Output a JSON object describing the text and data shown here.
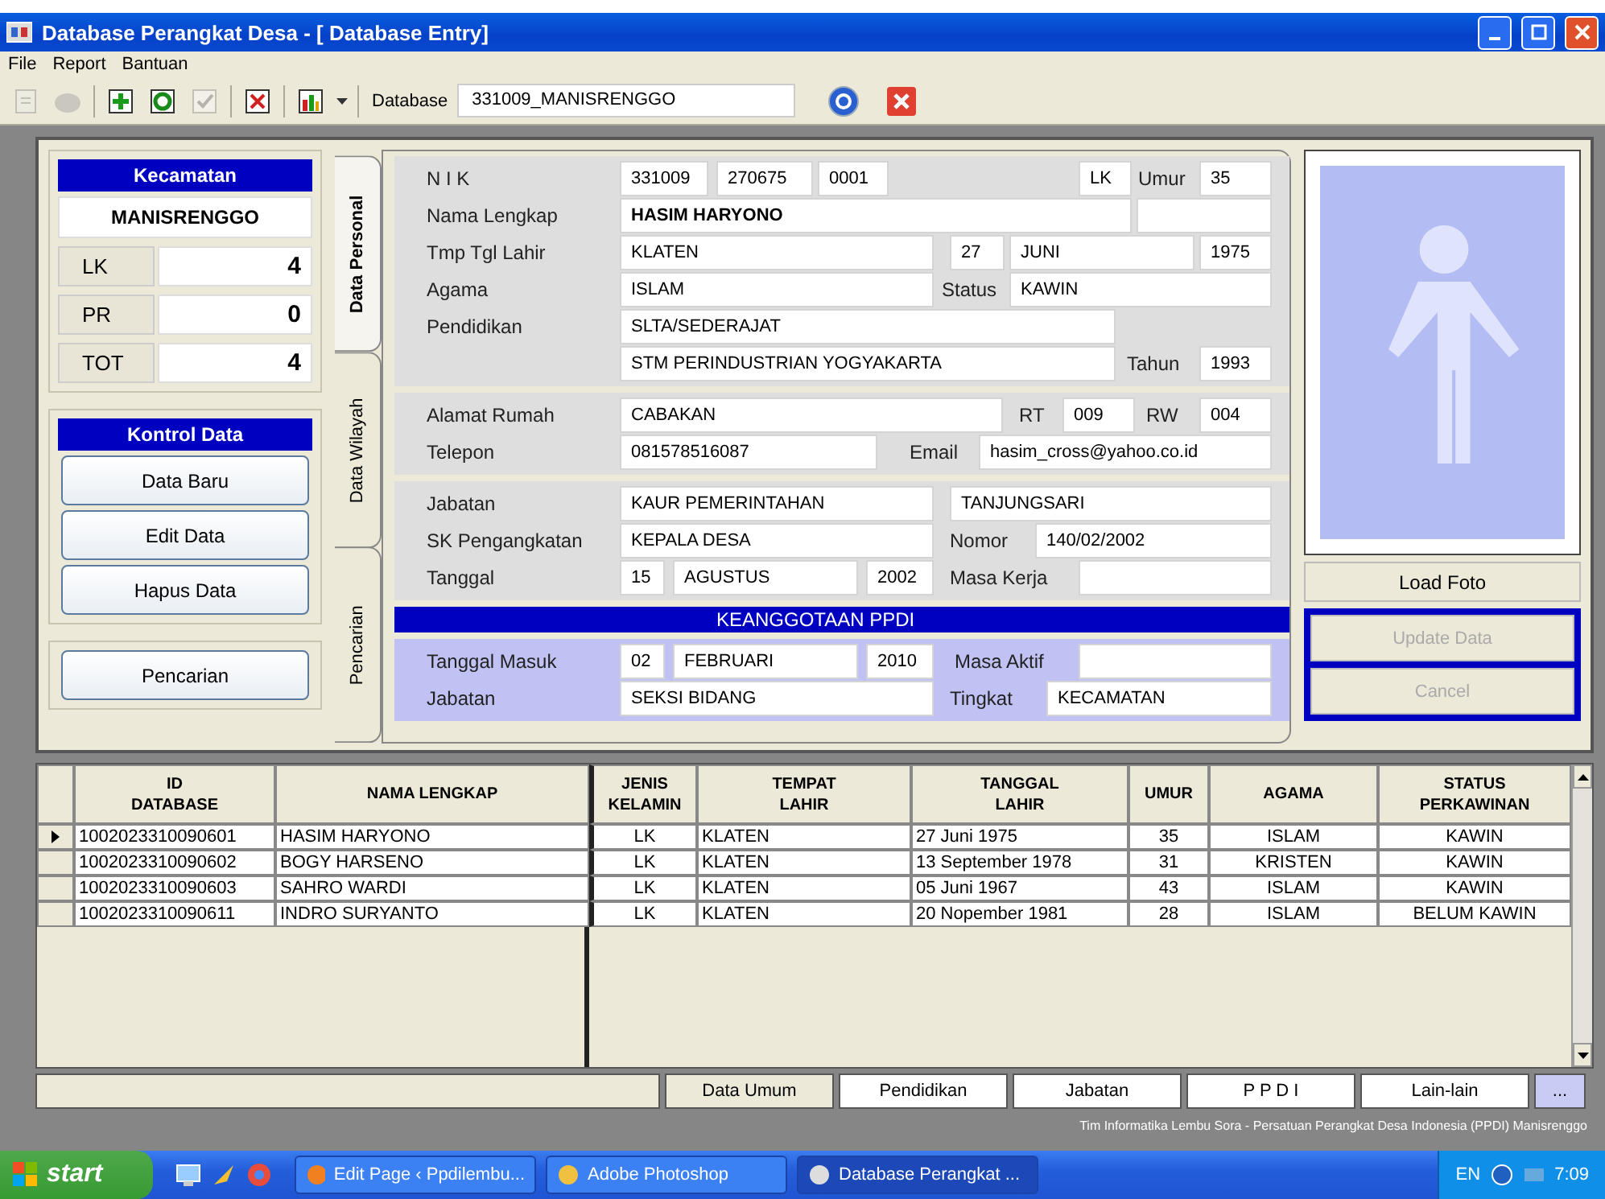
{
  "window": {
    "title": "Database Perangkat Desa - [ Database Entry]"
  },
  "menu": [
    "File",
    "Report",
    "Bantuan"
  ],
  "toolbar": {
    "tools": [
      {
        "disabled": true
      },
      {
        "disabled": true
      },
      {
        "disabled": false
      },
      {
        "disabled": false
      },
      {
        "disabled": true
      },
      {
        "disabled": false
      },
      {
        "disabled": false
      }
    ],
    "database_label": "Database",
    "database_value": "331009_MANISRENGGO"
  },
  "kecamatan": {
    "title": "Kecamatan",
    "value": "MANISRENGGO",
    "counts": [
      {
        "label": "LK",
        "value": "4"
      },
      {
        "label": "PR",
        "value": "0"
      },
      {
        "label": "TOT",
        "value": "4"
      }
    ]
  },
  "kontrol": {
    "title": "Kontrol Data",
    "buttons": [
      "Data Baru",
      "Edit Data",
      "Hapus Data"
    ]
  },
  "search_button": "Pencarian",
  "side_tabs": [
    {
      "label": "Data Personal",
      "selected": true
    },
    {
      "label": "Data Wilayah",
      "selected": false
    },
    {
      "label": "Pencarian",
      "selected": false
    }
  ],
  "form": {
    "sections": [
      {
        "kind": "plain",
        "rows": [
          {
            "label": "N I K",
            "items": [
              {
                "kind": "field",
                "value": "331009"
              },
              {
                "kind": "field",
                "value": "270675"
              },
              {
                "kind": "field",
                "value": "0001"
              },
              {
                "kind": "field",
                "value": "LK"
              },
              {
                "kind": "label",
                "text": "Umur"
              },
              {
                "kind": "field",
                "value": "35"
              }
            ]
          },
          {
            "label": "Nama Lengkap",
            "items": [
              {
                "kind": "field",
                "value": "HASIM HARYONO",
                "bold": true
              },
              {
                "kind": "field"
              }
            ]
          },
          {
            "label": "Tmp Tgl Lahir",
            "items": [
              {
                "kind": "field",
                "value": "KLATEN"
              },
              {
                "kind": "field",
                "value": "27"
              },
              {
                "kind": "field",
                "value": "JUNI"
              },
              {
                "kind": "field",
                "value": "1975"
              }
            ]
          },
          {
            "label": "Agama",
            "items": [
              {
                "kind": "field",
                "value": "ISLAM"
              },
              {
                "kind": "label",
                "text": "Status"
              },
              {
                "kind": "field",
                "value": "KAWIN"
              }
            ]
          },
          {
            "label": "Pendidikan",
            "items": [
              {
                "kind": "field",
                "value": "SLTA/SEDERAJAT"
              }
            ]
          },
          {
            "items": [
              {
                "kind": "field",
                "value": "STM PERINDUSTRIAN YOGYAKARTA"
              },
              {
                "kind": "label",
                "text": "Tahun"
              },
              {
                "kind": "field",
                "value": "1993"
              }
            ]
          }
        ]
      },
      {
        "kind": "plain",
        "rows": [
          {
            "label": "Alamat Rumah",
            "items": [
              {
                "kind": "field",
                "value": "CABAKAN"
              },
              {
                "kind": "label",
                "text": "RT"
              },
              {
                "kind": "field",
                "value": "009"
              },
              {
                "kind": "label",
                "text": "RW"
              },
              {
                "kind": "field",
                "value": "004"
              }
            ]
          },
          {
            "label": "Telepon",
            "items": [
              {
                "kind": "field",
                "value": "081578516087"
              },
              {
                "kind": "label",
                "text": "Email"
              },
              {
                "kind": "field",
                "value": "hasim_cross@yahoo.co.id"
              }
            ]
          }
        ]
      },
      {
        "kind": "plain",
        "rows": [
          {
            "label": "Jabatan",
            "items": [
              {
                "kind": "field",
                "value": "KAUR PEMERINTAHAN"
              },
              {
                "kind": "field",
                "value": "TANJUNGSARI"
              }
            ]
          },
          {
            "label": "SK Pengangkatan",
            "items": [
              {
                "kind": "field",
                "value": "KEPALA DESA"
              },
              {
                "kind": "label",
                "text": "Nomor"
              },
              {
                "kind": "field",
                "value": "140/02/2002"
              }
            ]
          },
          {
            "label": "Tanggal",
            "items": [
              {
                "kind": "field",
                "value": "15"
              },
              {
                "kind": "field",
                "value": "AGUSTUS"
              },
              {
                "kind": "field",
                "value": "2002"
              },
              {
                "kind": "label",
                "text": "Masa Kerja"
              },
              {
                "kind": "field"
              }
            ]
          }
        ]
      },
      {
        "kind": "header",
        "title": "KEANGGOTAAN PPDI"
      },
      {
        "kind": "member",
        "rows": [
          {
            "label": "Tanggal Masuk",
            "items": [
              {
                "kind": "field",
                "value": "02"
              },
              {
                "kind": "field",
                "value": "FEBRUARI"
              },
              {
                "kind": "field",
                "value": "2010"
              },
              {
                "kind": "label",
                "text": "Masa Aktif"
              },
              {
                "kind": "field"
              }
            ]
          },
          {
            "label": "Jabatan",
            "items": [
              {
                "kind": "field",
                "value": "SEKSI BIDANG"
              },
              {
                "kind": "label",
                "text": "Tingkat"
              },
              {
                "kind": "field",
                "value": "KECAMATAN"
              }
            ]
          }
        ]
      }
    ]
  },
  "photo": {
    "load_button": "Load Foto",
    "update_button": {
      "label": "Update Data",
      "disabled": true
    },
    "cancel_button": {
      "label": "Cancel",
      "disabled": true
    }
  },
  "table": {
    "columns": [
      "ID\nDATABASE",
      "NAMA LENGKAP",
      "JENIS\nKELAMIN",
      "TEMPAT\nLAHIR",
      "TANGGAL\nLAHIR",
      "UMUR",
      "AGAMA",
      "STATUS\nPERKAWINAN"
    ],
    "rows": [
      {
        "selected": true,
        "cells": [
          "1002023310090601",
          "HASIM HARYONO",
          "LK",
          "KLATEN",
          "27 Juni 1975",
          "35",
          "ISLAM",
          "KAWIN"
        ]
      },
      {
        "selected": false,
        "cells": [
          "1002023310090602",
          "BOGY HARSENO",
          "LK",
          "KLATEN",
          "13 September 1978",
          "31",
          "KRISTEN",
          "KAWIN"
        ]
      },
      {
        "selected": false,
        "cells": [
          "1002023310090603",
          "SAHRO WARDI",
          "LK",
          "KLATEN",
          "05 Juni 1967",
          "43",
          "ISLAM",
          "KAWIN"
        ]
      },
      {
        "selected": false,
        "cells": [
          "1002023310090611",
          "INDRO SURYANTO",
          "LK",
          "KLATEN",
          "20 Nopember 1981",
          "28",
          "ISLAM",
          "BELUM KAWIN"
        ]
      }
    ]
  },
  "bottom_tabs": [
    {
      "label": "Data Umum",
      "selected": true
    },
    {
      "label": "Pendidikan",
      "selected": false
    },
    {
      "label": "Jabatan",
      "selected": false
    },
    {
      "label": "P P D I",
      "selected": false
    },
    {
      "label": "Lain-lain",
      "selected": false
    }
  ],
  "more_button": "...",
  "credit": "Tim Informatika Lembu Sora - Persatuan Perangkat Desa Indonesia (PPDI) Manisrenggo",
  "taskbar": {
    "start": "start",
    "tasks": [
      {
        "label": "Edit Page ‹ Ppdilembu...",
        "selected": false
      },
      {
        "label": "Adobe Photoshop",
        "selected": false
      },
      {
        "label": "Database Perangkat ...",
        "selected": true
      }
    ],
    "language": "EN",
    "clock": "7:09"
  }
}
